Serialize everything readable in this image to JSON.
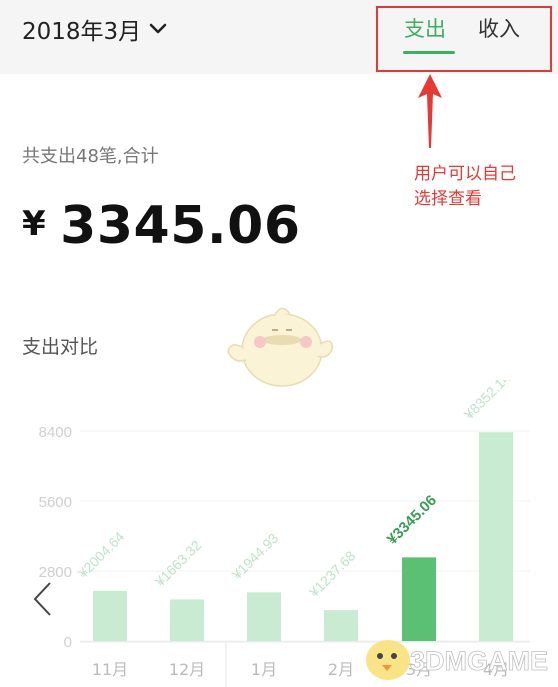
{
  "header": {
    "month_label": "2018年3月",
    "tabs": {
      "expense": "支出",
      "income": "收入"
    }
  },
  "summary": {
    "text": "共支出48笔,合计",
    "currency": "¥",
    "total": "3345.06"
  },
  "annotation": {
    "lines": [
      "用户可以自己",
      "选择查看"
    ]
  },
  "section": {
    "title": "支出对比"
  },
  "chart_data": {
    "type": "bar",
    "title": "",
    "categories": [
      "11月",
      "12月",
      "1月",
      "2月",
      "3月",
      "4月"
    ],
    "values": [
      2004.64,
      1663.32,
      1944.93,
      1237.68,
      3345.06,
      8352.14
    ],
    "value_labels": [
      "¥2004.64",
      "¥1663.32",
      "¥1944.93",
      "¥1237.68",
      "¥3345.06",
      "¥8352.14"
    ],
    "selected_index": 4,
    "yticks": [
      0,
      2800,
      5600,
      8400
    ],
    "ylim": [
      0,
      8400
    ],
    "grid": true,
    "colors": {
      "bar": "#c9ebd2",
      "selected": "#5bbf74",
      "selected_label": "#3c9d57",
      "label": "#bfe3c8"
    }
  },
  "watermark": {
    "text": "3DMGAME"
  },
  "colors": {
    "accent": "#3fae60",
    "annotation": "#e53935"
  },
  "icons": {
    "chevron": "chevron-down-icon",
    "nav_left": "chevron-left-icon"
  }
}
